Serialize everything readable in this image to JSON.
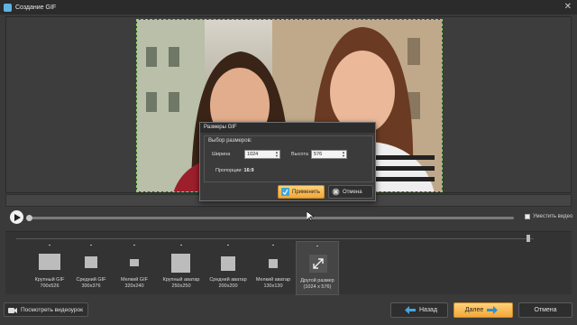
{
  "window": {
    "title": "Создание GIF",
    "close": "✕"
  },
  "player": {
    "hide_video": "Уместить видео",
    "position": 0.0
  },
  "sizes": [
    {
      "name": "Крупный GIF",
      "dims": "700x526"
    },
    {
      "name": "Средний GIF",
      "dims": "300x376"
    },
    {
      "name": "Мелкий GIF",
      "dims": "320x240"
    },
    {
      "name": "Крупный аватар",
      "dims": "250x250"
    },
    {
      "name": "Средний аватар",
      "dims": "200x200"
    },
    {
      "name": "Мелкий аватар",
      "dims": "130x130"
    },
    {
      "name": "Другой размер",
      "dims": "(1024 x 576)"
    }
  ],
  "dialog": {
    "title": "Размеры GIF",
    "group_title": "Выбор размеров:",
    "width_label": "Ширина",
    "width_value": "1024",
    "height_label": "Высота",
    "height_value": "576",
    "ratio_label": "Пропорции:",
    "ratio_value": "16:9",
    "apply": "Применить",
    "cancel": "Отмена"
  },
  "footer": {
    "tutorial": "Посмотреть видеоурок",
    "back": "Назад",
    "next": "Далее",
    "cancel": "Отмена"
  },
  "colors": {
    "accent": "#f3a739",
    "frame_border": "#8fcf6a",
    "back_arrow": "#4aa3df",
    "next_arrow": "#2f8fd0"
  },
  "icons": {
    "play": "play-icon",
    "back": "arrow-left-icon",
    "next": "arrow-right-icon",
    "expand": "expand-icon",
    "tutorial": "video-camera-icon"
  }
}
